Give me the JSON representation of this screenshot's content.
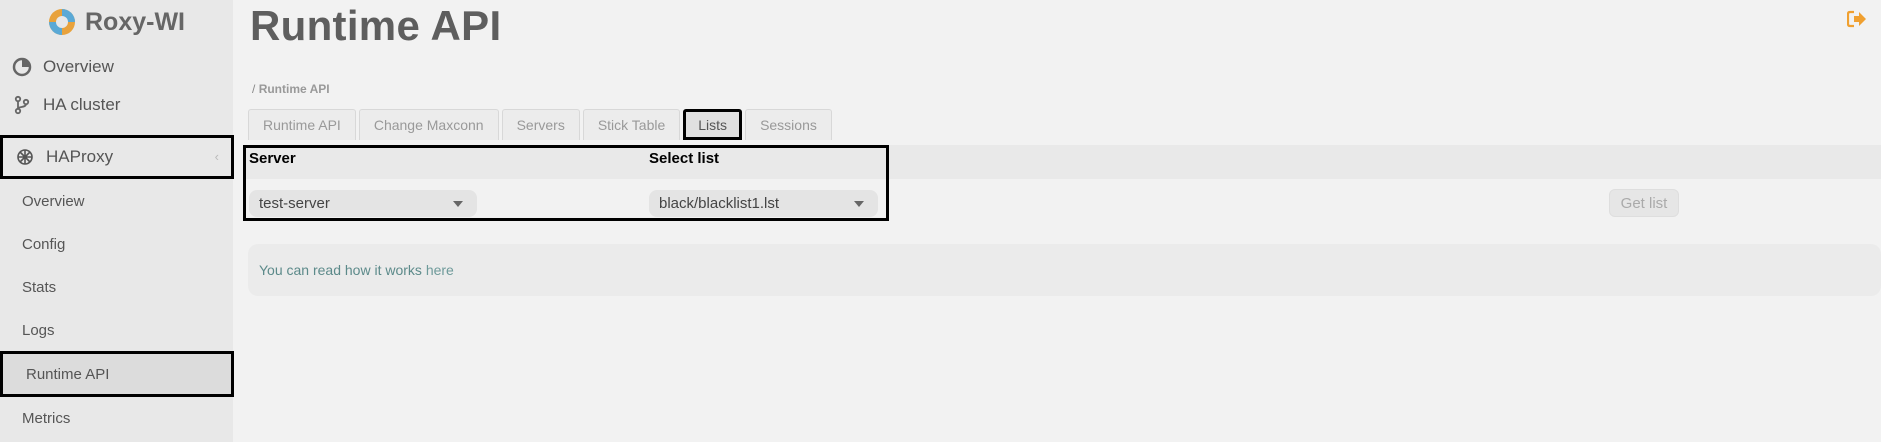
{
  "app": {
    "name": "Roxy-WI"
  },
  "sidebar": {
    "items": [
      {
        "label": "Overview",
        "icon": "overview-icon"
      },
      {
        "label": "HA cluster",
        "icon": "branch-icon"
      },
      {
        "label": "HAProxy",
        "icon": "haproxy-icon"
      }
    ],
    "sub_items": [
      {
        "label": "Overview"
      },
      {
        "label": "Config"
      },
      {
        "label": "Stats"
      },
      {
        "label": "Logs"
      },
      {
        "label": "Runtime API"
      },
      {
        "label": "Metrics"
      }
    ]
  },
  "page": {
    "title": "Runtime API",
    "breadcrumb_sep": "/",
    "breadcrumb": "Runtime API"
  },
  "tabs": [
    {
      "label": "Runtime API"
    },
    {
      "label": "Change Maxconn"
    },
    {
      "label": "Servers"
    },
    {
      "label": "Stick Table"
    },
    {
      "label": "Lists",
      "active": true
    },
    {
      "label": "Sessions"
    }
  ],
  "form": {
    "server_label": "Server",
    "server_value": "test-server",
    "list_label": "Select list",
    "list_value": "black/blacklist1.lst",
    "get_button": "Get list"
  },
  "info": {
    "link_text": "You can read how it works",
    "tail": "here"
  },
  "colors": {
    "accent": "#f0a030",
    "sidebar_bg": "#e8e8e8",
    "main_bg": "#f2f2f2"
  }
}
